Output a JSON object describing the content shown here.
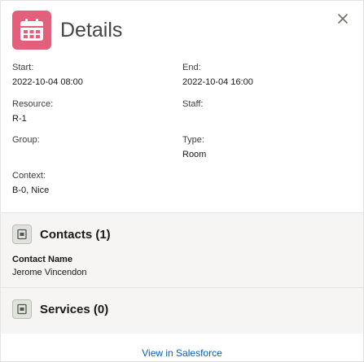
{
  "header": {
    "title": "Details",
    "icon": "calendar-icon",
    "icon_color": "#e3607d"
  },
  "close": {
    "icon": "close-icon"
  },
  "fields": {
    "start": {
      "label": "Start:",
      "value": "2022-10-04 08:00"
    },
    "end": {
      "label": "End:",
      "value": "2022-10-04 16:00"
    },
    "resource": {
      "label": "Resource:",
      "value": "R-1"
    },
    "staff": {
      "label": "Staff:",
      "value": ""
    },
    "group": {
      "label": "Group:",
      "value": ""
    },
    "type": {
      "label": "Type:",
      "value": "Room"
    },
    "context": {
      "label": "Context:",
      "value": "B-0, Nice"
    }
  },
  "contacts": {
    "title": "Contacts (1)",
    "icon": "contact-card-icon",
    "column_label": "Contact Name",
    "items": [
      "Jerome Vincendon"
    ]
  },
  "services": {
    "title": "Services (0)",
    "icon": "services-card-icon"
  },
  "footer": {
    "link": "View in Salesforce",
    "link_color": "#0b5cab"
  }
}
